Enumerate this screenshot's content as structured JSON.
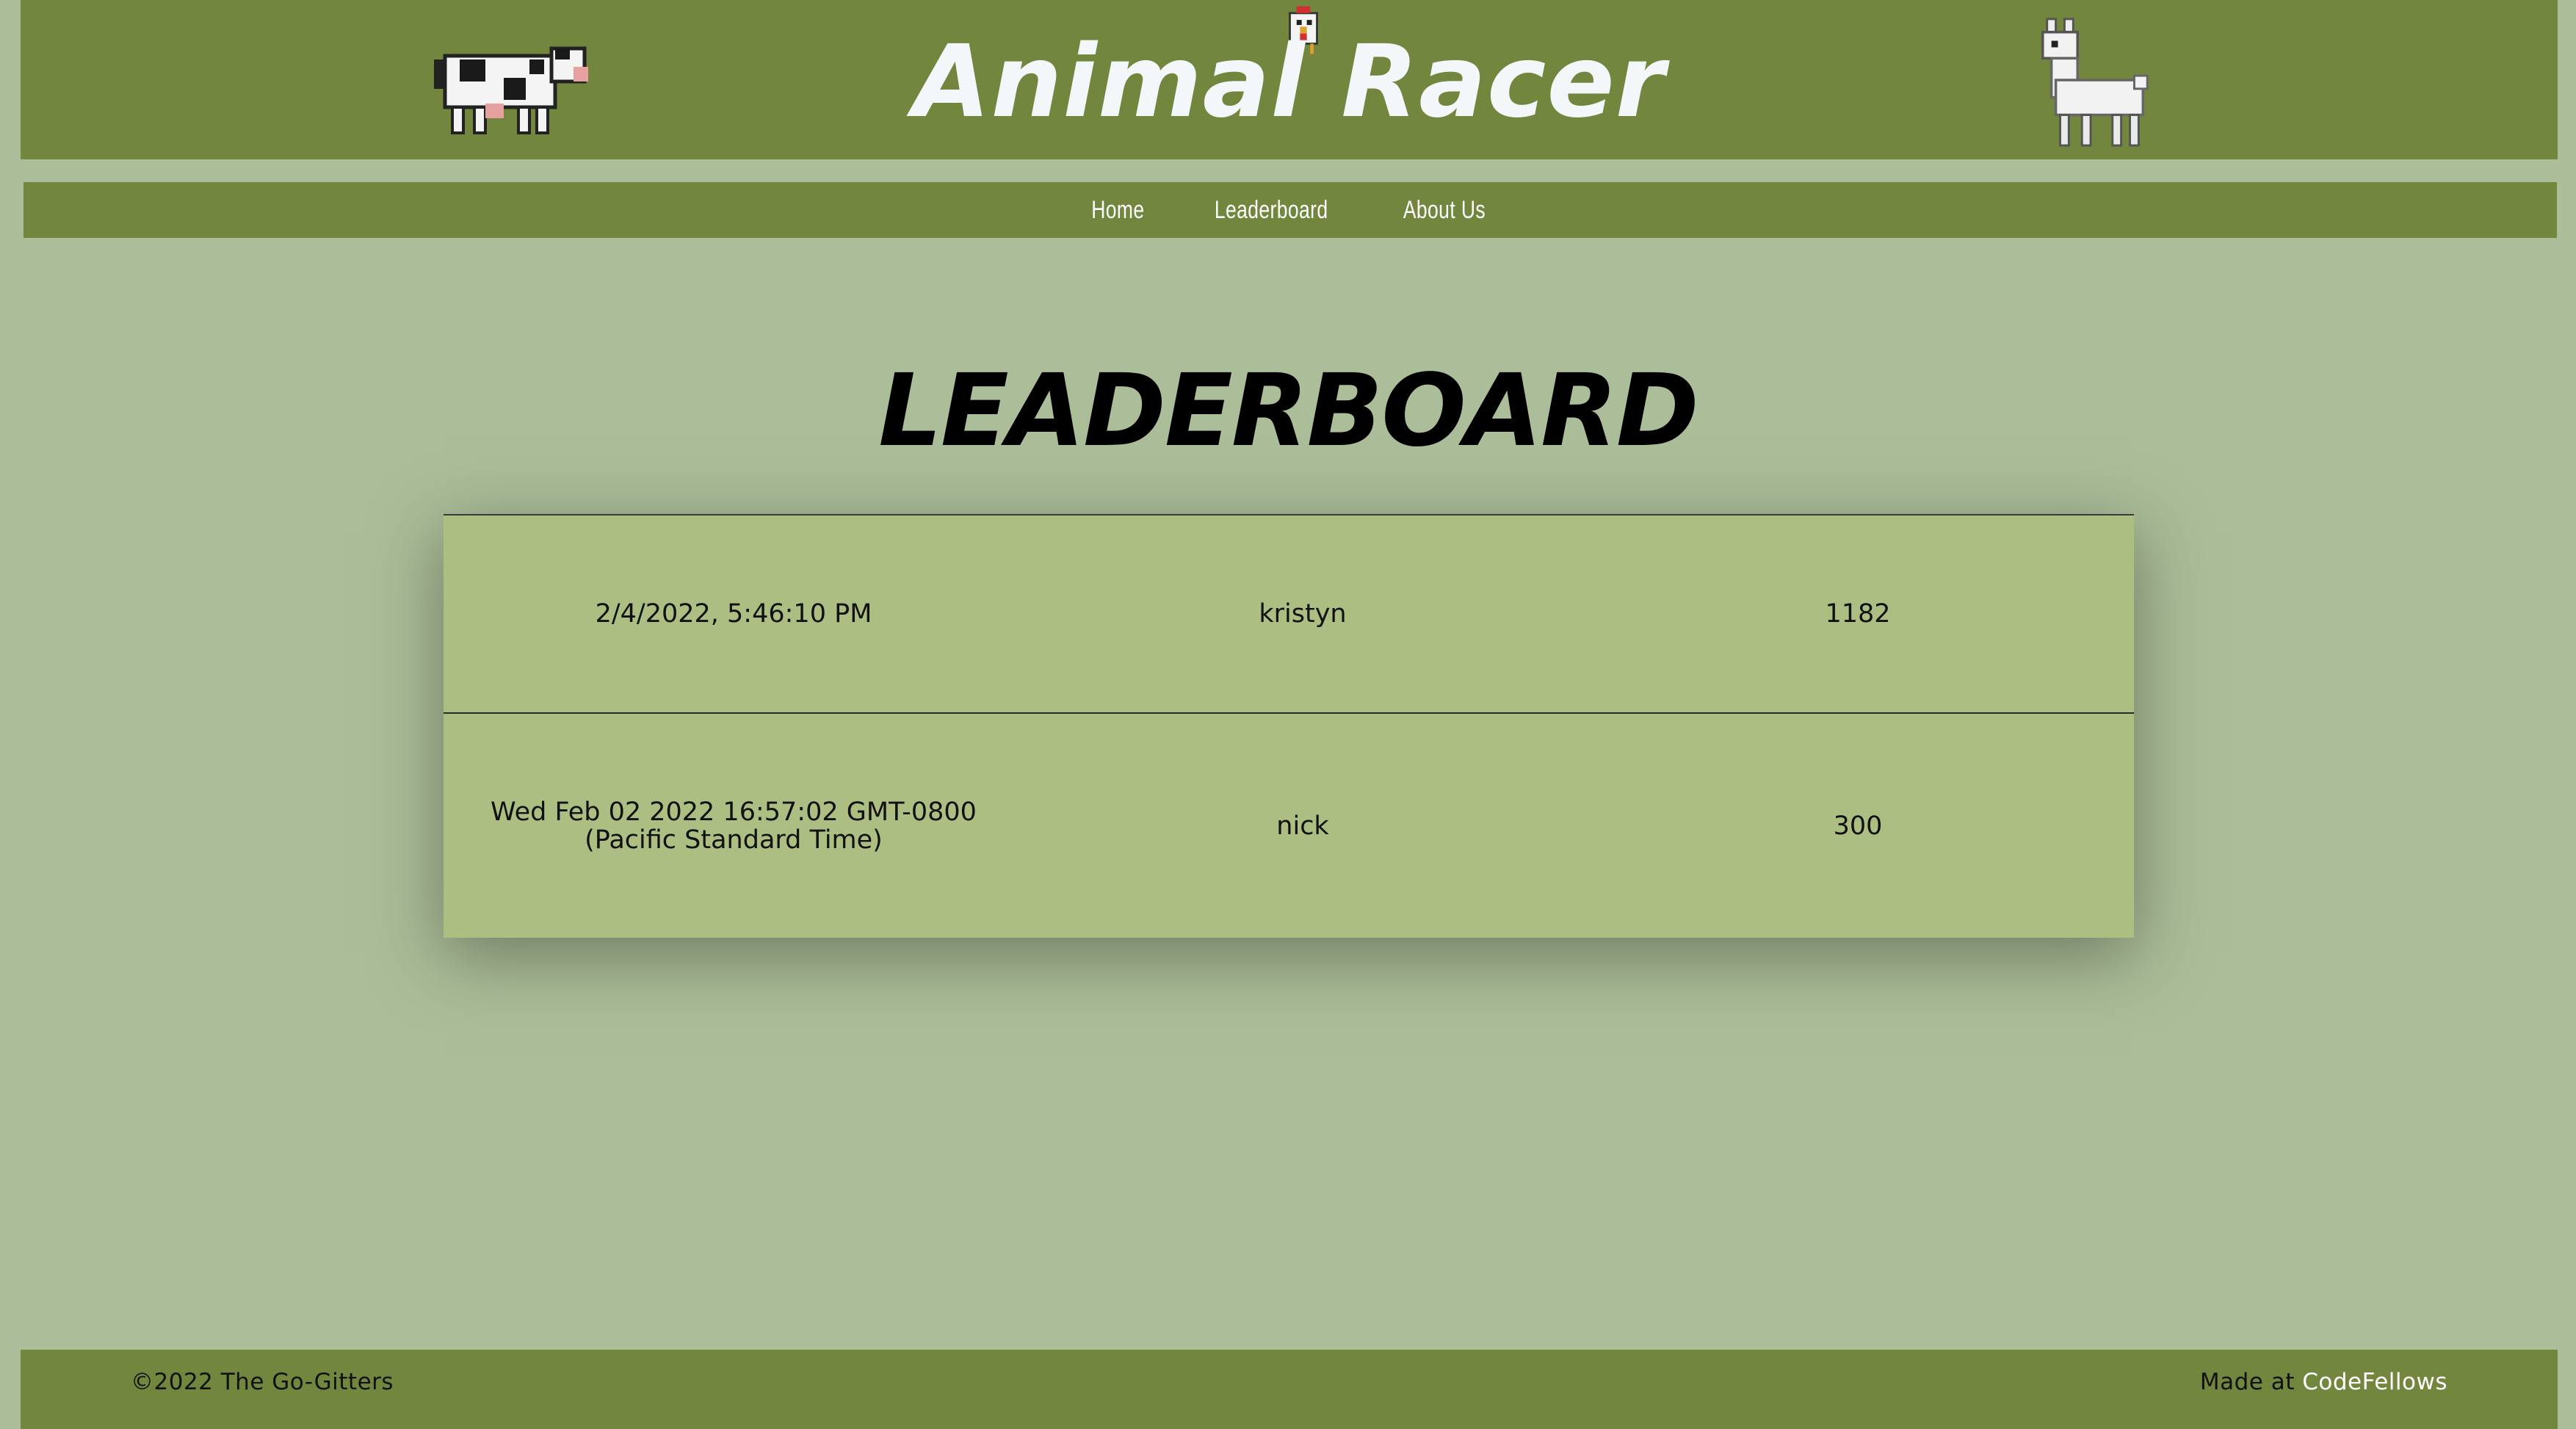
{
  "header": {
    "title": "Animal Racer",
    "sprites": [
      "cow-sprite",
      "chicken-sprite",
      "llama-sprite"
    ]
  },
  "nav": {
    "items": [
      {
        "label": "Home"
      },
      {
        "label": "Leaderboard"
      },
      {
        "label": "About Us"
      }
    ]
  },
  "main": {
    "heading": "LEADERBOARD",
    "rows": [
      {
        "date": "2/4/2022, 5:46:10 PM",
        "name": "kristyn",
        "score": "1182"
      },
      {
        "date": "Wed Feb 02 2022 16:57:02 GMT-0800 (Pacific Standard Time)",
        "name": "nick",
        "score": "300"
      }
    ]
  },
  "footer": {
    "copyright": "©2022 The Go-Gitters",
    "made_prefix": "Made at ",
    "made_link": "CodeFellows"
  },
  "colors": {
    "background": "#abbd99",
    "header_bg": "#72873d",
    "table_bg": "#acbe81",
    "title_text": "#f4f7fa"
  }
}
